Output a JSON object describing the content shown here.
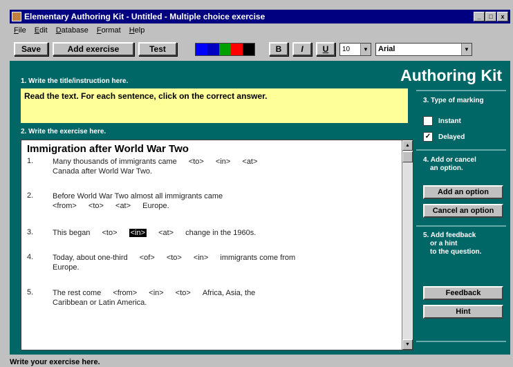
{
  "window": {
    "title": "Elementary Authoring Kit - Untitled - Multiple choice exercise",
    "controls": [
      "_",
      "□",
      "x"
    ]
  },
  "menu": [
    "File",
    "Edit",
    "Database",
    "Format",
    "Help"
  ],
  "toolbar": {
    "save_label": "Save",
    "add_exercise_label": "Add exercise",
    "test_label": "Test",
    "colors": [
      "#0000ff",
      "#0000c0",
      "#00a000",
      "#ff0000",
      "#000000"
    ],
    "bold_label": "B",
    "italic_label": "I",
    "underline_label": "U",
    "font_size": "10",
    "font_name": "Arial"
  },
  "brand": "Authoring Kit",
  "section1": {
    "header": "1. Write the title/instruction here.",
    "text": "Read the text.  For each sentence, click on the correct answer."
  },
  "section2": {
    "header": "2. Write the exercise here.",
    "exercise_title": "Immigration after World War Two",
    "items": [
      {
        "num": "1.",
        "line1_pre": "Many thousands of immigrants came",
        "options": [
          "<to>",
          "<in>",
          "<at>"
        ],
        "line2": "Canada after World War Two."
      },
      {
        "num": "2.",
        "line1_pre": "Before World War Two almost all immigrants came",
        "options": [
          "<from>",
          "<to>",
          "<at>"
        ],
        "line2_post": "Europe."
      },
      {
        "num": "3.",
        "line1_pre": "This  began",
        "options": [
          "<to>",
          "<in>",
          "<at>"
        ],
        "selected_index": 1,
        "line1_post": "change in the 1960s."
      },
      {
        "num": "4.",
        "line1_pre": "Today, about one-third",
        "options": [
          "<of>",
          "<to>",
          "<in>"
        ],
        "line1_post": "immigrants come from",
        "line2": "Europe."
      },
      {
        "num": "5.",
        "line1_pre": "The rest come",
        "options": [
          "<from>",
          "<in>",
          "<to>"
        ],
        "line1_post": "Africa, Asia, the",
        "line2": "Caribbean or Latin America."
      }
    ]
  },
  "section3": {
    "header": "3. Type of marking",
    "instant_label": "Instant",
    "instant_checked": false,
    "delayed_label": "Delayed",
    "delayed_checked": true
  },
  "section4": {
    "header_line1": "4. Add or cancel",
    "header_line2": "an option.",
    "add_option_label": "Add an option",
    "cancel_option_label": "Cancel an option"
  },
  "section5": {
    "header_line1": "5. Add feedback",
    "header_line2": "or a hint",
    "header_line3": "to the question.",
    "feedback_label": "Feedback",
    "hint_label": "Hint"
  },
  "status": "Write your exercise here."
}
